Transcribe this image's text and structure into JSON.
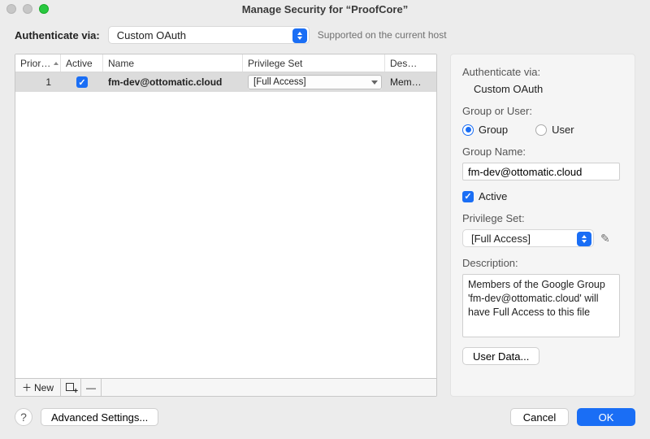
{
  "window": {
    "title": "Manage Security for “ProofCore”"
  },
  "auth": {
    "label": "Authenticate via:",
    "value": "Custom OAuth",
    "hint": "Supported on the current host"
  },
  "table": {
    "columns": {
      "priority": "Prior…",
      "active": "Active",
      "name": "Name",
      "privilege": "Privilege Set",
      "description": "Des…"
    },
    "rows": [
      {
        "priority": "1",
        "active": true,
        "name": "fm-dev@ottomatic.cloud",
        "privilege": "[Full Access]",
        "description": "Mem…"
      }
    ]
  },
  "toolbar": {
    "new": "New",
    "remove_symbol": "—"
  },
  "detail": {
    "auth_via_label": "Authenticate via:",
    "auth_via_value": "Custom OAuth",
    "group_or_user_label": "Group or User:",
    "group_label": "Group",
    "user_label": "User",
    "group_name_label": "Group Name:",
    "group_name_value": "fm-dev@ottomatic.cloud",
    "active_label": "Active",
    "privilege_set_label": "Privilege Set:",
    "privilege_set_value": "[Full Access]",
    "description_label": "Description:",
    "description_value": "Members of the Google Group 'fm-dev@ottomatic.cloud' will have Full Access to this file",
    "user_data_label": "User Data..."
  },
  "footer": {
    "advanced": "Advanced Settings...",
    "cancel": "Cancel",
    "ok": "OK"
  },
  "colors": {
    "accent": "#1a6ef5"
  }
}
